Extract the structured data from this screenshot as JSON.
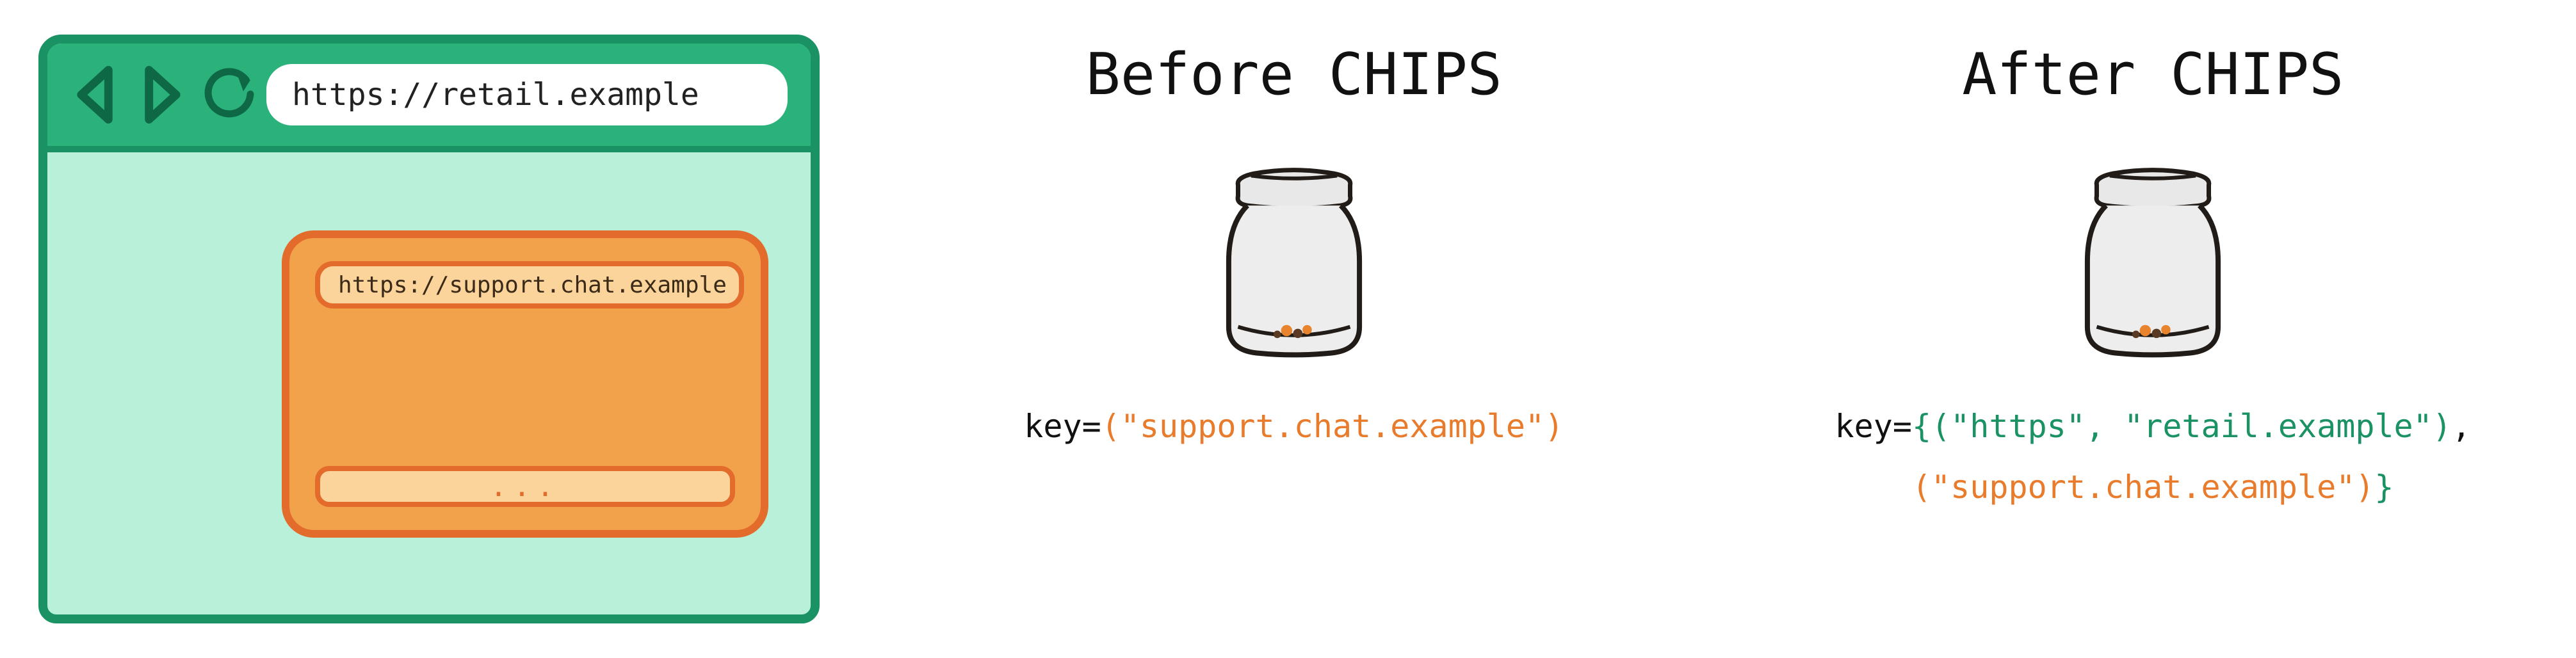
{
  "browser": {
    "url": "https://retail.example",
    "chat": {
      "url": "https://support.chat.example",
      "placeholder": "..."
    }
  },
  "panels": {
    "before": {
      "title": "Before CHIPS",
      "key_prefix": "key=",
      "key_value": "(\"support.chat.example\")"
    },
    "after": {
      "title": "After CHIPS",
      "key_prefix": "key=",
      "brace_open": "{",
      "tuple1_open": "(",
      "tuple1_a": "\"https\"",
      "tuple1_sep": ", ",
      "tuple1_b": "\"retail.example\"",
      "tuple1_close": ")",
      "after_tuple1": ",",
      "tuple2": "(\"support.chat.example\")",
      "brace_close": "}"
    }
  },
  "colors": {
    "browser_border": "#1a9263",
    "browser_toolbar": "#2bb17a",
    "browser_body": "#b9f0d9",
    "widget_fill": "#f2a24a",
    "widget_border": "#e36b2c",
    "widget_light": "#fbd49c",
    "key_orange": "#e87c2c",
    "key_green": "#1a9263"
  }
}
